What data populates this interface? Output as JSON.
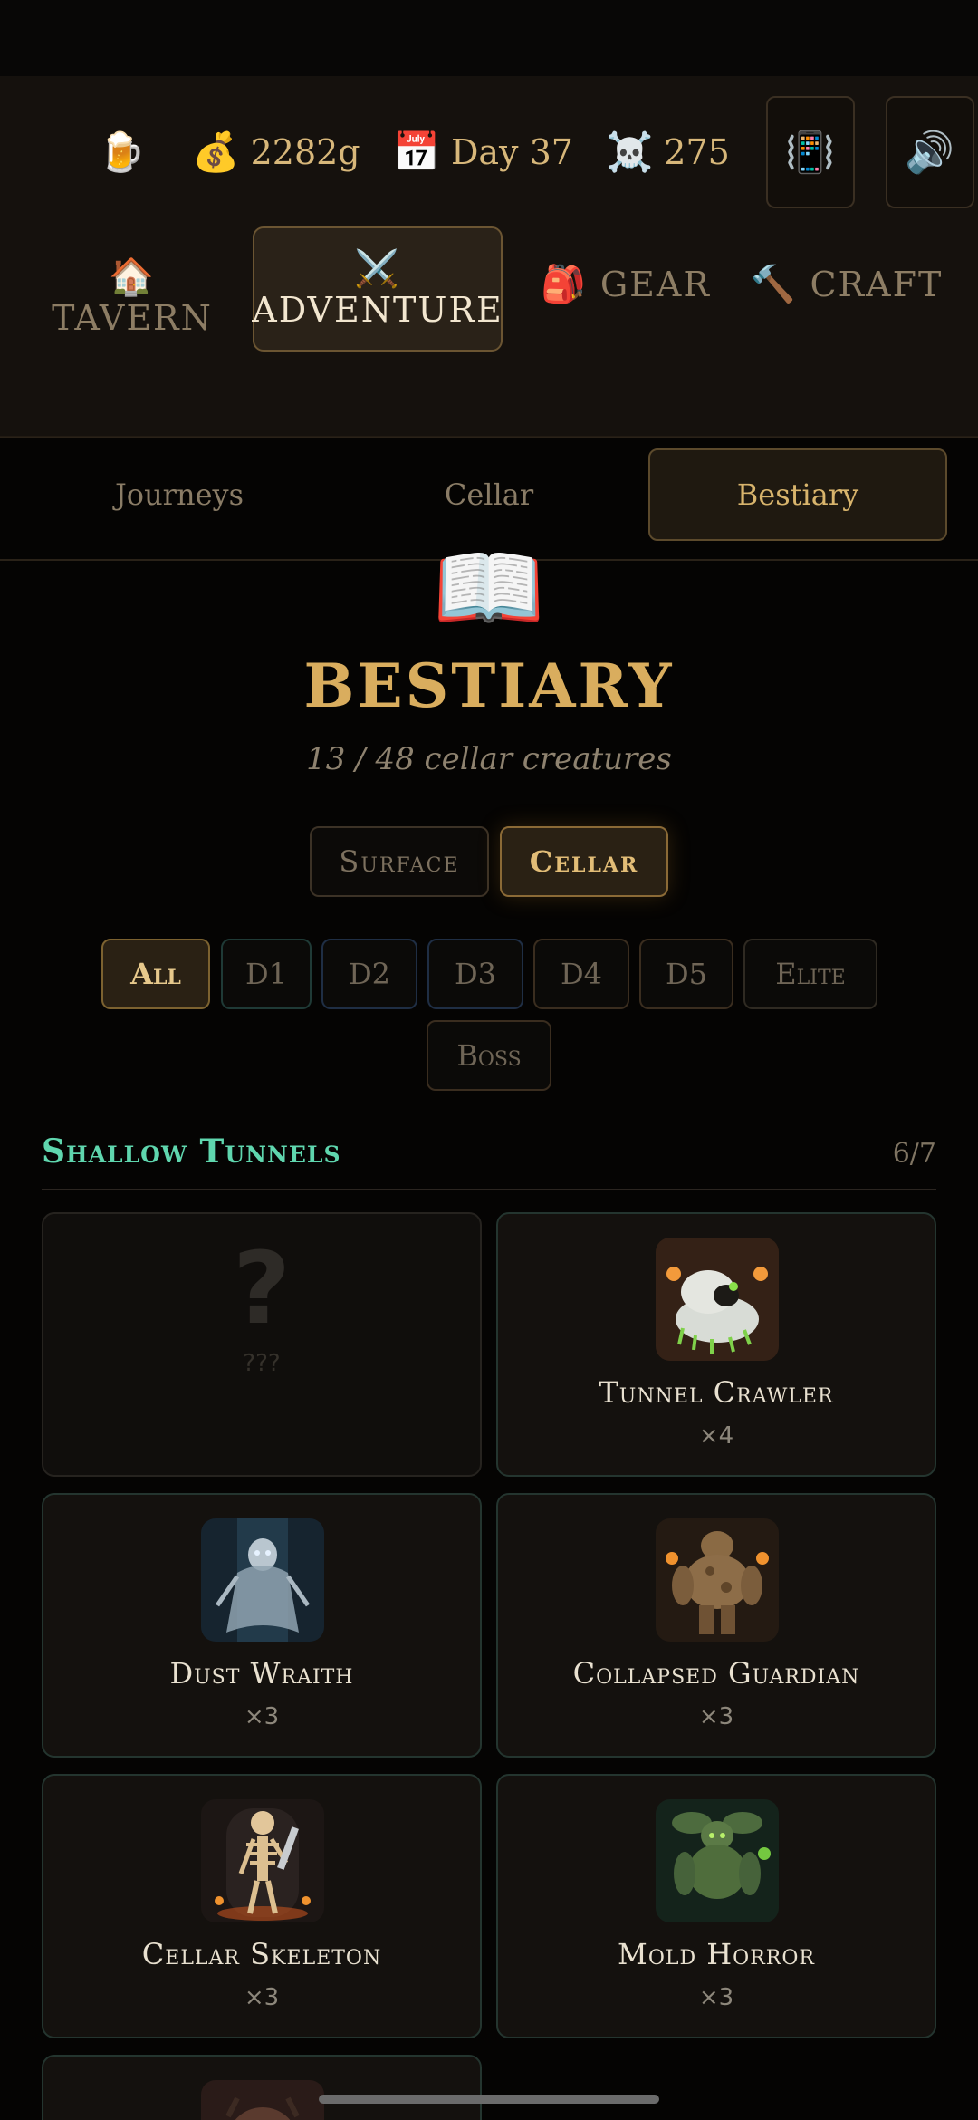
{
  "resources": {
    "beer_icon": "🍺",
    "gold_icon": "💰",
    "gold": "2282g",
    "day_icon": "📅",
    "day": "Day 37",
    "kills_icon": "☠️",
    "kills": "275",
    "vibrate_icon": "📳",
    "sound_icon": "🔊"
  },
  "main_nav": {
    "tavern": {
      "icon": "🏠",
      "label": "TAVERN"
    },
    "adventure": {
      "icon": "⚔️",
      "label": "ADVENTURE"
    },
    "gear": {
      "icon": "🎒",
      "label": "GEAR"
    },
    "craft": {
      "icon": "🔨",
      "label": "CRAFT"
    }
  },
  "sub_nav": {
    "journeys": "Journeys",
    "cellar": "Cellar",
    "bestiary": "Bestiary"
  },
  "header": {
    "icon": "📖",
    "title": "BESTIARY",
    "subtitle": "13 / 48 cellar creatures"
  },
  "location_toggle": {
    "surface": "Surface",
    "cellar": "Cellar"
  },
  "filters": {
    "all": "All",
    "d1": "D1",
    "d2": "D2",
    "d3": "D3",
    "d4": "D4",
    "d5": "D5",
    "elite": "Elite",
    "boss": "Boss"
  },
  "section": {
    "title": "Shallow Tunnels",
    "count": "6/7"
  },
  "creatures": [
    {
      "name": "???",
      "count": "",
      "unknown_mark": "?"
    },
    {
      "name": "Tunnel Crawler",
      "count": "×4"
    },
    {
      "name": "Dust Wraith",
      "count": "×3"
    },
    {
      "name": "Collapsed Guardian",
      "count": "×3"
    },
    {
      "name": "Cellar Skeleton",
      "count": "×3"
    },
    {
      "name": "Mold Horror",
      "count": "×3"
    }
  ],
  "colors": {
    "accent_gold": "#d9ad5e",
    "section_teal": "#5fd6ae",
    "background": "#050403"
  }
}
